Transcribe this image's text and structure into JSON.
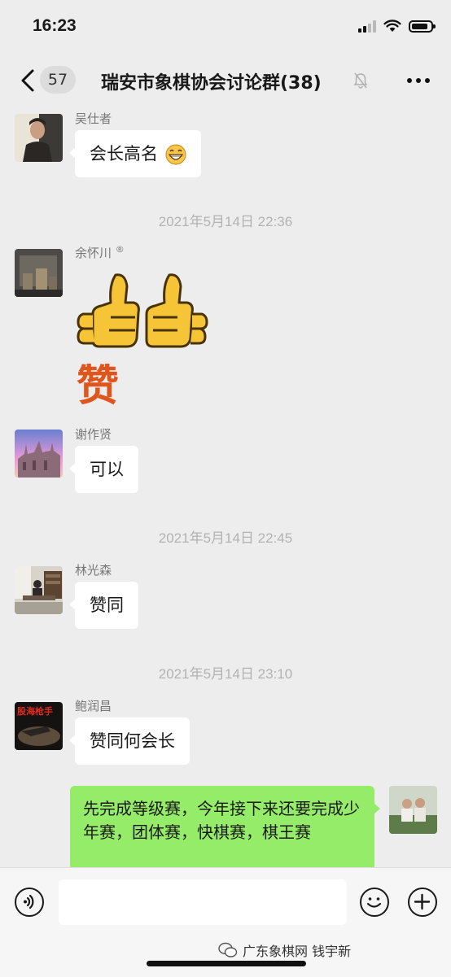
{
  "status_bar": {
    "time": "16:23"
  },
  "header": {
    "unread_count": "57",
    "title": "瑞安市象棋协会讨论群(38)"
  },
  "messages": [
    {
      "sender": "吴仕者",
      "text": "会长高名"
    },
    {
      "timestamp": "2021年5月14日 22:36"
    },
    {
      "sender": "余怀川",
      "sticker_text": "赞"
    },
    {
      "sender": "谢作贤",
      "text": "可以"
    },
    {
      "timestamp": "2021年5月14日 22:45"
    },
    {
      "sender": "林光森",
      "text": "赞同"
    },
    {
      "timestamp": "2021年5月14日 23:10"
    },
    {
      "sender": "鲍润昌",
      "avatar_text": "股海枪手",
      "text": "赞同何会长"
    },
    {
      "self": true,
      "text": "先完成等级赛，今年接下来还要完成少年赛，团体赛，快棋赛，棋王赛"
    }
  ],
  "input": {
    "value": ""
  },
  "watermark": "广东象棋网 钱宇新",
  "colors": {
    "background": "#ededed",
    "self_bubble": "#95ec69",
    "other_bubble": "#ffffff"
  }
}
